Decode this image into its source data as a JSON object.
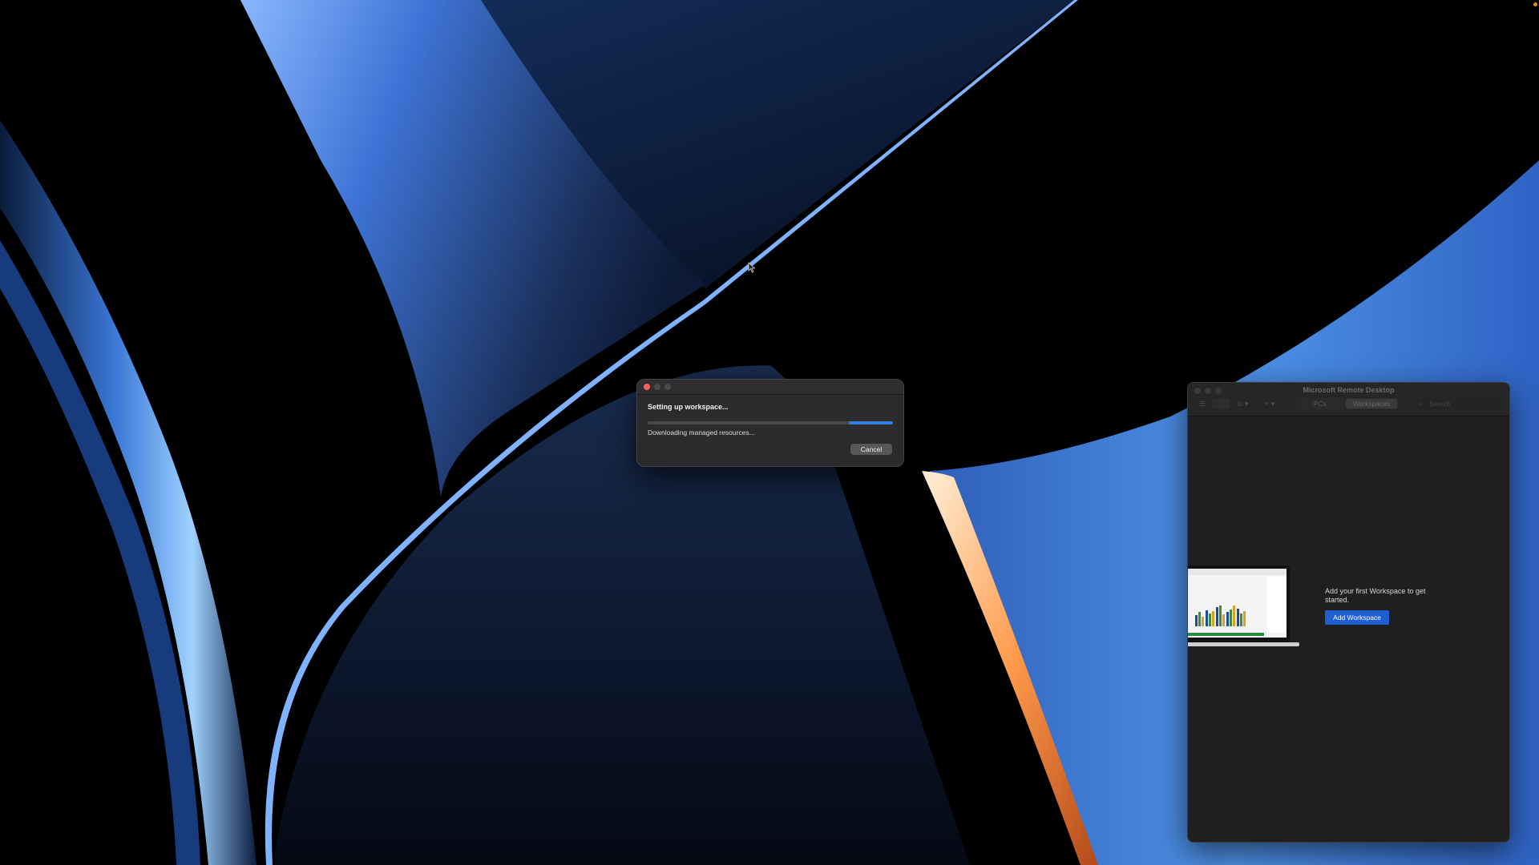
{
  "dialog": {
    "title": "Setting up workspace...",
    "status": "Downloading managed resources...",
    "cancel_label": "Cancel",
    "progress_fraction": 0.18,
    "progress_start_fraction": 0.82
  },
  "remote_desktop": {
    "window_title": "Microsoft Remote Desktop",
    "tabs": [
      {
        "label": "PCs",
        "active": false
      },
      {
        "label": "Workspaces",
        "active": true
      }
    ],
    "search_placeholder": "Search",
    "empty_message": "Add your first Workspace to get started.",
    "add_button_label": "Add Workspace"
  },
  "colors": {
    "accent_blue": "#1f5fd1",
    "progress_blue": "#2f7de1",
    "close_red": "#fe5f57"
  }
}
